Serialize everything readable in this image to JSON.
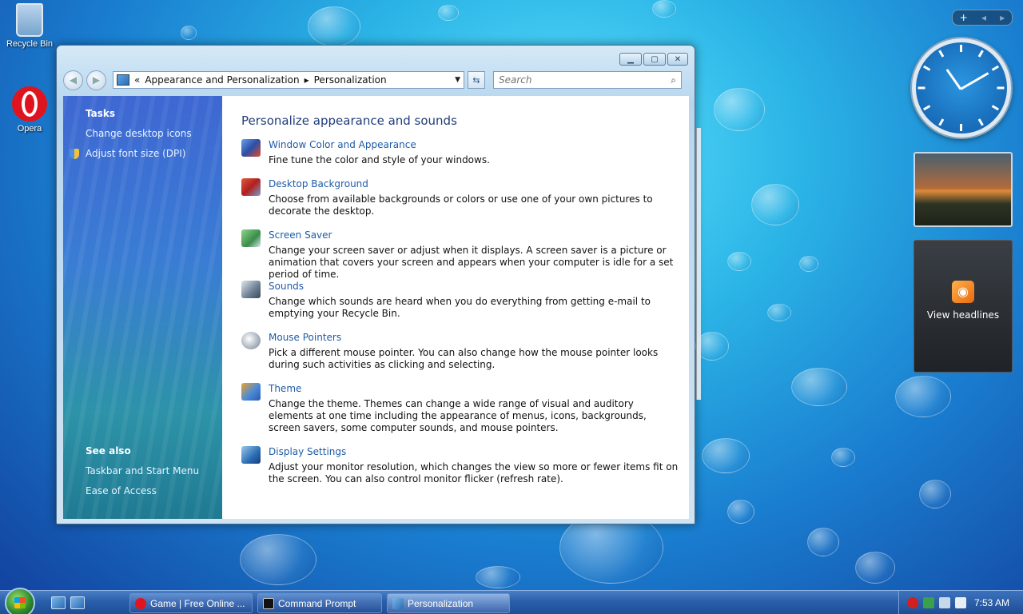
{
  "desktop": {
    "icons": [
      {
        "label": "Recycle Bin"
      },
      {
        "label": "Opera"
      }
    ]
  },
  "window": {
    "address": {
      "sep": "«",
      "crumb1": "Appearance and Personalization",
      "arrow": "▸",
      "crumb2": "Personalization"
    },
    "search_placeholder": "Search",
    "sidebar": {
      "tasks_title": "Tasks",
      "tasks": [
        "Change desktop icons",
        "Adjust font size (DPI)"
      ],
      "see_also_title": "See also",
      "see_also": [
        "Taskbar and Start Menu",
        "Ease of Access"
      ]
    },
    "content": {
      "heading": "Personalize appearance and sounds",
      "items": [
        {
          "title": "Window Color and Appearance",
          "desc": "Fine tune the color and style of your windows."
        },
        {
          "title": "Desktop Background",
          "desc": "Choose from available backgrounds or colors or use one of your own pictures to decorate the desktop."
        },
        {
          "title": "Screen Saver",
          "desc": "Change your screen saver or adjust when it displays. A screen saver is a picture or animation that covers your screen and appears when your computer is idle for a set period of time."
        },
        {
          "title": "Sounds",
          "desc": "Change which sounds are heard when you do everything from getting e-mail to emptying your Recycle Bin."
        },
        {
          "title": "Mouse Pointers",
          "desc": "Pick a different mouse pointer. You can also change how the mouse pointer looks during such activities as clicking and selecting."
        },
        {
          "title": "Theme",
          "desc": "Change the theme. Themes can change a wide range of visual and auditory elements at one time including the appearance of menus, icons, backgrounds, screen savers, some computer sounds, and mouse pointers."
        },
        {
          "title": "Display Settings",
          "desc": "Adjust your monitor resolution, which changes the view so more or fewer items fit on the screen. You can also control monitor flicker (refresh rate)."
        }
      ]
    }
  },
  "gadgets": {
    "feed_label": "View headlines",
    "bar_add": "+",
    "bar_prev": "◂",
    "bar_next": "▸"
  },
  "taskbar": {
    "tasks": [
      {
        "label": "Game | Free Online ..."
      },
      {
        "label": "Command Prompt"
      },
      {
        "label": "Personalization"
      }
    ],
    "clock": "7:53 AM"
  },
  "colors": {
    "link": "#1e5ba8",
    "heading": "#1f3d7a",
    "taskbar": "#2a5fab"
  }
}
